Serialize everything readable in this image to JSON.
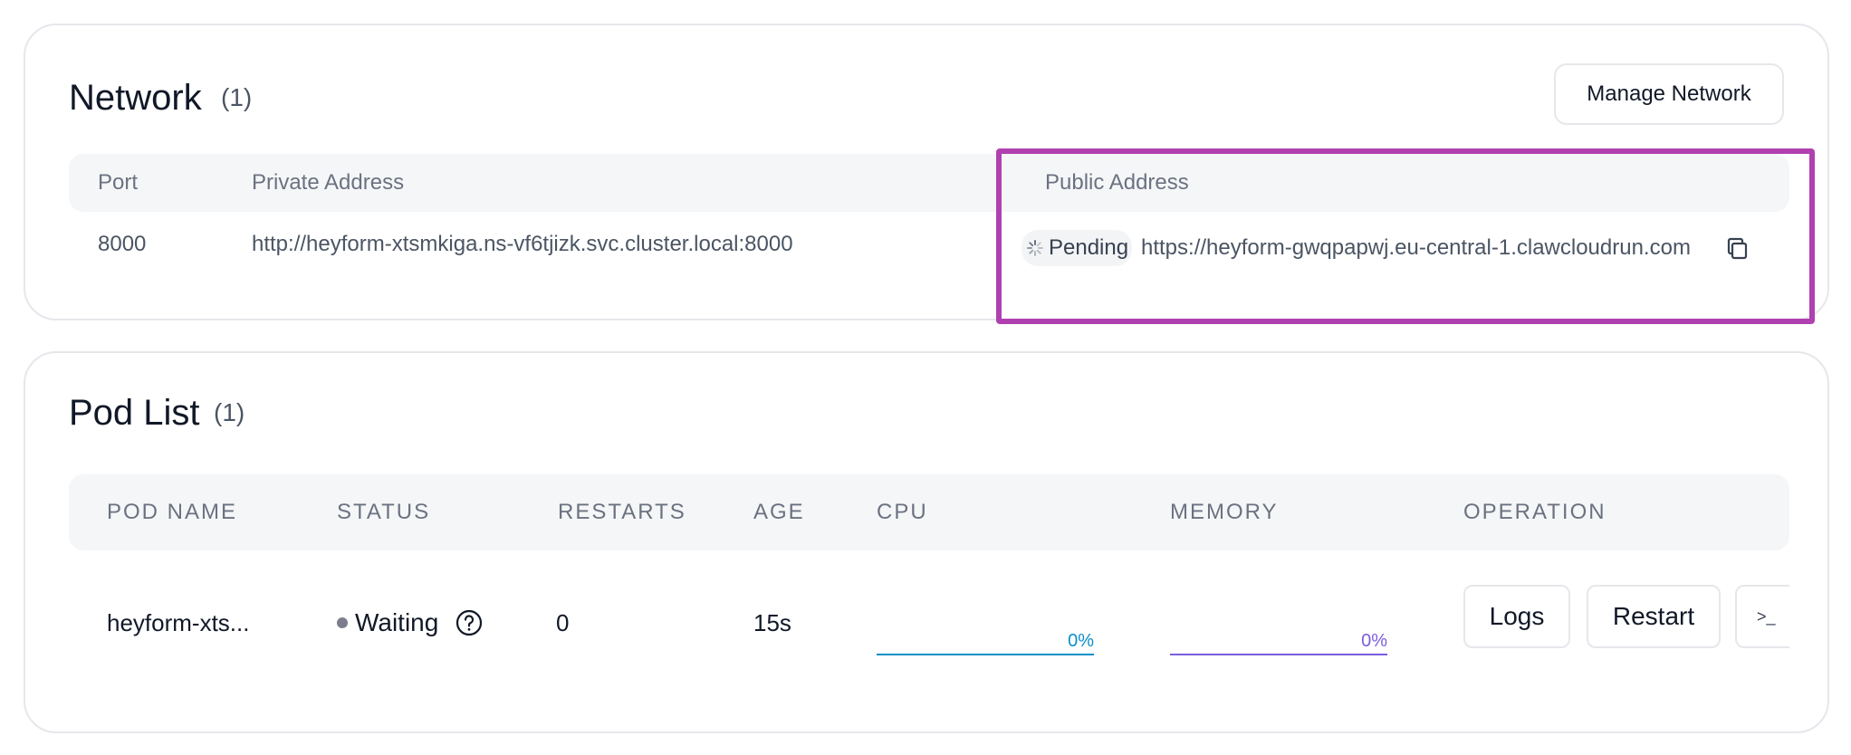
{
  "network": {
    "title": "Network",
    "count": "(1)",
    "manage_button": "Manage Network",
    "columns": [
      "Port",
      "Private Address",
      "Public Address"
    ],
    "row": {
      "port": "8000",
      "private_address": "http://heyform-xtsmkiga.ns-vf6tjizk.svc.cluster.local:8000",
      "public_status": "Pending",
      "public_address": "https://heyform-gwqpapwj.eu-central-1.clawcloudrun.com"
    },
    "highlight_color": "#b040b0"
  },
  "pods": {
    "title": "Pod List",
    "count": "(1)",
    "columns": [
      "POD NAME",
      "STATUS",
      "RESTARTS",
      "AGE",
      "CPU",
      "MEMORY",
      "OPERATION"
    ],
    "row": {
      "name": "heyform-xts...",
      "status": "Waiting",
      "restarts": "0",
      "age": "15s",
      "cpu_percent": "0%",
      "memory_percent": "0%",
      "cpu_color": "#0b8ec7",
      "memory_color": "#7c5ce0"
    },
    "operations": {
      "logs": "Logs",
      "restart": "Restart",
      "terminal": ">_"
    }
  }
}
